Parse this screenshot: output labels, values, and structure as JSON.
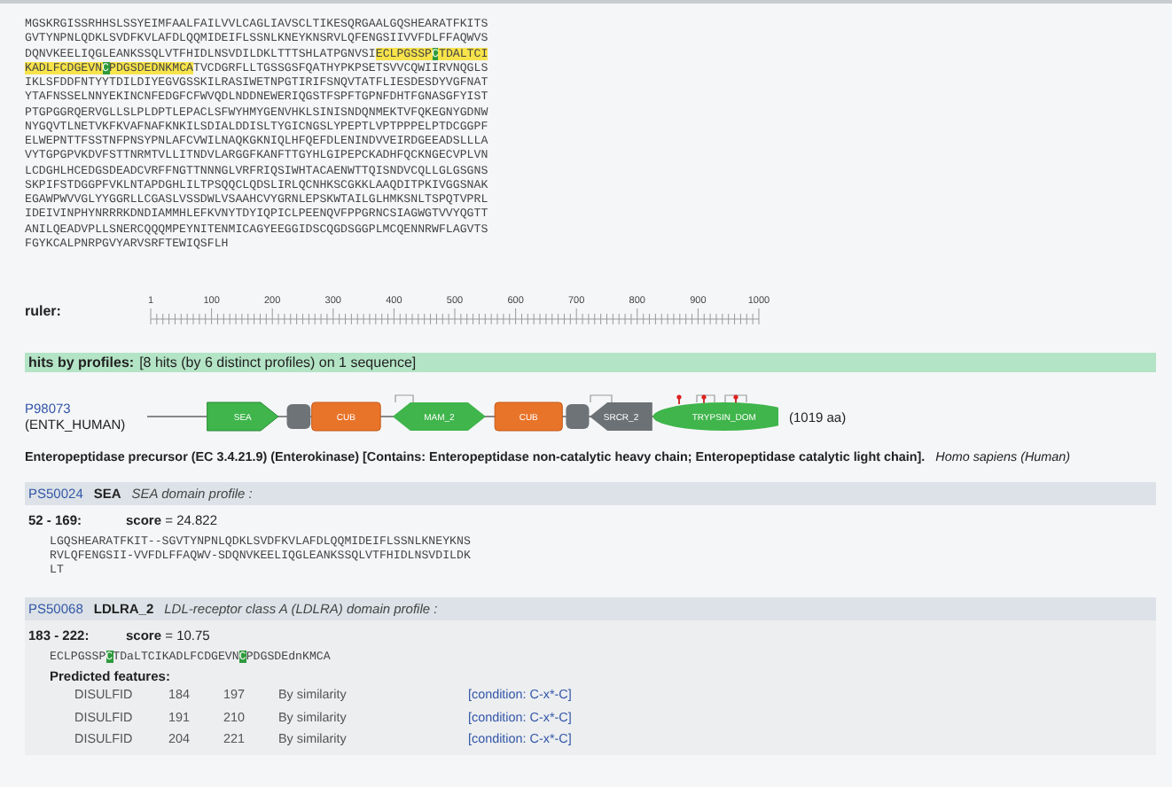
{
  "sequence": [
    [
      {
        "text": "MGSKRGISSRHHSLSSYEIMFAALFAILVVLCAGLIAVSCLTIKESQRGAALGQSHEARATFKITS",
        "kind": "plain"
      }
    ],
    [
      {
        "text": "GVTYNPNLQDKLSVDFKVLAFDLQQMIDEIFLSSNLKNEYKNSRVLQFENGSIIVVFDLFFAQWVS",
        "kind": "plain"
      }
    ],
    [
      {
        "text": "DQNVKEELIQGLEANKSSQLVTFHIDLNSVDILDKLTTTSHLATPGNVSI",
        "kind": "plain"
      },
      {
        "text": "ECLPGSSP",
        "kind": "match"
      },
      {
        "text": "C",
        "kind": "site"
      },
      {
        "text": "TDALTCI",
        "kind": "match"
      }
    ],
    [
      {
        "text": "KADLFCDGEVN",
        "kind": "match"
      },
      {
        "text": "C",
        "kind": "site"
      },
      {
        "text": "PDGSDEDNKMCA",
        "kind": "match"
      },
      {
        "text": "TVCDGRFLLTGSSGSFQATHYPKPSETSVVCQWIIRVNQGLS",
        "kind": "plain"
      }
    ],
    [
      {
        "text": "IKLSFDDFNTYYTDILDIYEGVGSSKILRASIWETNPGTIRIFSNQVTATFLIESDESDYVGFNAT",
        "kind": "plain"
      }
    ],
    [
      {
        "text": "YTAFNSSELNNYEKINCNFEDGFCFWVQDLNDDNEWERIQGSTFSPFTGPNFDHTFGNASGFYIST",
        "kind": "plain"
      }
    ],
    [
      {
        "text": "PTGPGGRQERVGLLSLPLDPTLEPACLSFWYHMYGENVHKLSINISNDQNMEKTVFQKEGNYGDNW",
        "kind": "plain"
      }
    ],
    [
      {
        "text": "NYGQVTLNETVKFKVAFNAFKNKILSDIALDDISLTYGICNGSLYPEPTLVPTPPPELPTDCGGPF",
        "kind": "plain"
      }
    ],
    [
      {
        "text": "ELWEPNTTFSSTNFPNSYPNLAFCVWILNAQKGKNIQLHFQEFDLENINDVVEIRDGEEADSLLLA",
        "kind": "plain"
      }
    ],
    [
      {
        "text": "VYTGPGPVKDVFSTTNRMTVLLITNDVLARGGFKANFTTGYHLGIPEPCKADHFQCKNGECVPLVN",
        "kind": "plain"
      }
    ],
    [
      {
        "text": "LCDGHLHCEDGSDEADCVRFFNGTTNNNGLVRFRIQSIWHTACAENWTTQISNDVCQLLGLGSGNS",
        "kind": "plain"
      }
    ],
    [
      {
        "text": "SKPIFSTDGGPFVKLNTAPDGHLILTPSQQCLQDSLIRLQCNHKSCGKKLAAQDITPKIVGGSNAK",
        "kind": "plain"
      }
    ],
    [
      {
        "text": "EGAWPWVVGLYYGGRLLCGASLVSSDWLVSAAHCVYGRNLEPSKWTAILGLHMKSNLTSPQTVPRL",
        "kind": "plain"
      }
    ],
    [
      {
        "text": "IDEIVINPHYNRRRKDNDIAMMHLEFKVNYTDYIQPICLPEENQVFPPGRNCSIAGWGTVVYQGTT",
        "kind": "plain"
      }
    ],
    [
      {
        "text": "ANILQEADVPLLSNERCQQQMPEYNITENMICAGYEEGGIDSCQGDSGGPLMCQENNRWFLAGVTS",
        "kind": "plain"
      }
    ],
    [
      {
        "text": "FGYKCALPNRPGVYARVSRFTEWIQSFLH",
        "kind": "plain"
      }
    ]
  ],
  "ruler": {
    "label": "ruler:",
    "ticks": [
      "1",
      "100",
      "200",
      "300",
      "400",
      "500",
      "600",
      "700",
      "800",
      "900",
      "1000"
    ]
  },
  "hits_banner": {
    "label": "hits by profiles:",
    "summary": "[8 hits (by 6 distinct profiles) on 1 sequence]"
  },
  "protein": {
    "accession": "P98073",
    "entry_name": "(ENTK_HUMAN)",
    "length": "(1019 aa)",
    "domains": [
      {
        "kind": "arrow",
        "label": "SEA"
      },
      {
        "kind": "small"
      },
      {
        "kind": "box",
        "label": "CUB"
      },
      {
        "kind": "hexagon",
        "label": "MAM_2"
      },
      {
        "kind": "box",
        "label": "CUB"
      },
      {
        "kind": "small"
      },
      {
        "kind": "grey-arrow",
        "label": "SRCR_2"
      },
      {
        "kind": "ellipse",
        "label": "TRYPSIN_DOM"
      }
    ],
    "description": "Enteropeptidase precursor (EC 3.4.21.9) (Enterokinase) [Contains: Enteropeptidase non-catalytic heavy chain; Enteropeptidase catalytic light chain].",
    "organism": "Homo sapiens (Human)"
  },
  "profiles": [
    {
      "accession": "PS50024",
      "name": "SEA",
      "description": "SEA domain profile :",
      "range": "52 - 169:",
      "score": "score = 24.822",
      "alignment": [
        [
          {
            "text": "LGQSHEARATFKIT--SGVTYNPNLQDKLSVDFKVLAFDLQQMIDEIFLSSNLKNEYKNS",
            "kind": "plain"
          }
        ],
        [
          {
            "text": "RVLQFENGSII-VVFDLFFAQWV-SDQNVKEELIQGLEANKSSQLVTFHIDLNSVDILDK",
            "kind": "plain"
          }
        ],
        [
          {
            "text": "LT",
            "kind": "plain"
          }
        ]
      ]
    },
    {
      "accession": "PS50068",
      "name": "LDLRA_2",
      "description": "LDL-receptor class A (LDLRA) domain profile :",
      "range": "183 - 222:",
      "score": "score = 10.75",
      "alignment": [
        [
          {
            "text": "ECLPGSSP",
            "kind": "plain"
          },
          {
            "text": "C",
            "kind": "site"
          },
          {
            "text": "TDaLTCIKADLFCDGEVN",
            "kind": "plain"
          },
          {
            "text": "C",
            "kind": "site"
          },
          {
            "text": "PDGSDEdnKMCA",
            "kind": "plain"
          }
        ]
      ],
      "features_title": "Predicted features:",
      "features": [
        {
          "type": "DISULFID",
          "start": "184",
          "end": "197",
          "note": "By similarity",
          "condition": "[condition: C-x*-C]"
        },
        {
          "type": "DISULFID",
          "start": "191",
          "end": "210",
          "note": "By similarity",
          "condition": "[condition: C-x*-C]"
        },
        {
          "type": "DISULFID",
          "start": "204",
          "end": "221",
          "note": "By similarity",
          "condition": "[condition: C-x*-C]"
        }
      ]
    }
  ]
}
